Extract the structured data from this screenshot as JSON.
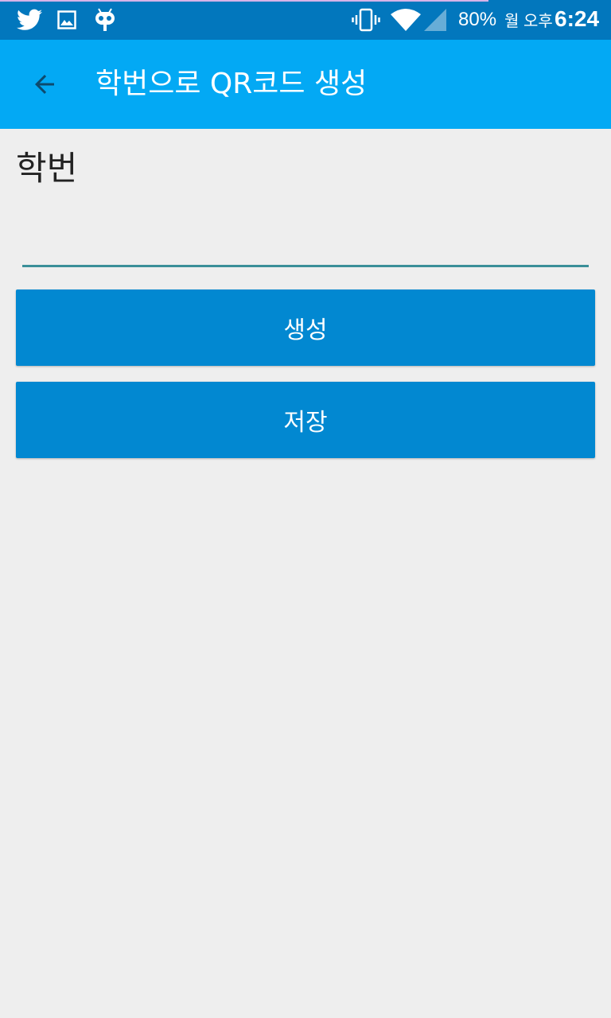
{
  "status_bar": {
    "icons_left": [
      "twitter-icon",
      "image-icon",
      "cyanogen-mascot-icon"
    ],
    "icons_right": [
      "vibrate-icon",
      "wifi-icon",
      "cell-signal-icon"
    ],
    "battery": "80%",
    "ampm": "월 오후",
    "time": "6:24"
  },
  "app_bar": {
    "back_icon": "arrow-back-icon",
    "title": "학번으로 QR코드 생성"
  },
  "form": {
    "label": "학번",
    "input_value": "",
    "input_placeholder": ""
  },
  "buttons": {
    "generate_label": "생성",
    "save_label": "저장"
  },
  "colors": {
    "status_bar": "#0277bd",
    "app_bar": "#03a9f4",
    "button": "#0288d1",
    "background": "#eeeeee",
    "input_underline": "#3a8f98"
  }
}
